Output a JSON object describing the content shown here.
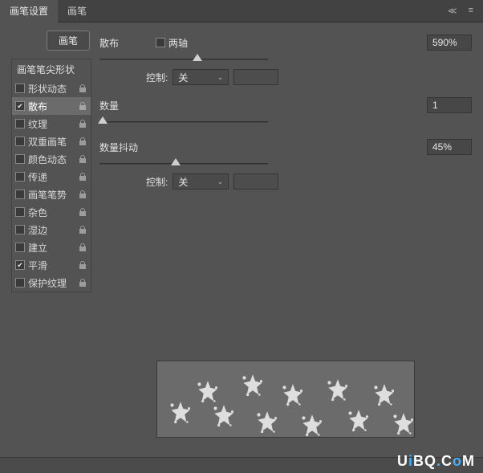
{
  "tabs": {
    "settings": "画笔设置",
    "brush": "画笔"
  },
  "topButton": "画笔",
  "list": {
    "header": "画笔笔尖形状",
    "items": [
      {
        "label": "形状动态",
        "checked": false,
        "locked": true
      },
      {
        "label": "散布",
        "checked": true,
        "locked": true
      },
      {
        "label": "纹理",
        "checked": false,
        "locked": true
      },
      {
        "label": "双重画笔",
        "checked": false,
        "locked": true
      },
      {
        "label": "颜色动态",
        "checked": false,
        "locked": true
      },
      {
        "label": "传递",
        "checked": false,
        "locked": true
      },
      {
        "label": "画笔笔势",
        "checked": false,
        "locked": true
      },
      {
        "label": "杂色",
        "checked": false,
        "locked": true
      },
      {
        "label": "湿边",
        "checked": false,
        "locked": true
      },
      {
        "label": "建立",
        "checked": false,
        "locked": true
      },
      {
        "label": "平滑",
        "checked": true,
        "locked": true
      },
      {
        "label": "保护纹理",
        "checked": false,
        "locked": true
      }
    ]
  },
  "scatter": {
    "label": "散布",
    "bothAxesLabel": "两轴",
    "bothAxesChecked": false,
    "value": "590%",
    "sliderPos": 58,
    "controlLabel": "控制:",
    "controlValue": "关"
  },
  "count": {
    "label": "数量",
    "value": "1",
    "sliderPos": 2
  },
  "countJitter": {
    "label": "数量抖动",
    "value": "45%",
    "sliderPos": 45,
    "controlLabel": "控制:",
    "controlValue": "关"
  },
  "watermark": "UiBQ.CoM"
}
